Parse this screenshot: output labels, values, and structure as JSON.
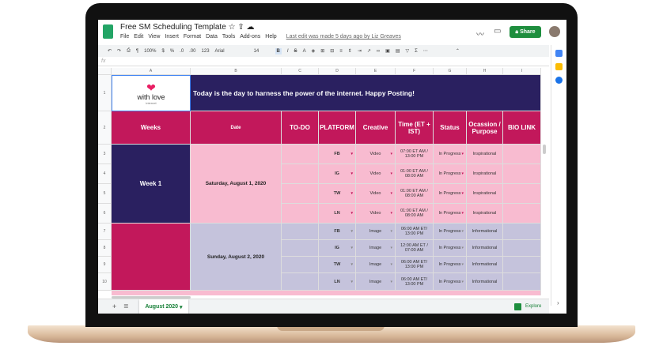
{
  "app": {
    "title": "Free SM Scheduling Template",
    "last_edit": "Last edit was made 5 days ago by Liz Greaves",
    "share": "Share",
    "explore": "Explore"
  },
  "menu": [
    "File",
    "Edit",
    "View",
    "Insert",
    "Format",
    "Data",
    "Tools",
    "Add-ons",
    "Help"
  ],
  "toolbar": {
    "zoom": "100%",
    "currency": "$",
    "percent": "%",
    "dec_less": ".0",
    "dec_more": ".00",
    "format": "123",
    "font": "Arial",
    "size": "14",
    "bold": "B",
    "italic": "I",
    "strike": "S",
    "textcolor": "A"
  },
  "formula": {
    "fx": "fx"
  },
  "columns": [
    "A",
    "B",
    "C",
    "D",
    "E",
    "F",
    "G",
    "H",
    "I"
  ],
  "rows": [
    "1",
    "2",
    "3",
    "4",
    "5",
    "6",
    "7",
    "8",
    "9",
    "10"
  ],
  "banner": {
    "logo_text": "with love",
    "logo_sub": "internet",
    "message": "Today is the day to harness the power of the internet. Happy Posting!"
  },
  "headers": [
    "Weeks",
    "Date",
    "TO-DO",
    "PLATFORM",
    "Creative",
    "Time (ET + IST)",
    "Status",
    "Ocassion / Purpose",
    "BIO LINK"
  ],
  "weeks": [
    {
      "week": "Week 1",
      "date": "Saturday, August 1, 2020",
      "entries": [
        {
          "platform": "FB",
          "creative": "Video",
          "time": "07:00 ET AM / 13:00 PM",
          "status": "In Progress",
          "purpose": "Inspirational"
        },
        {
          "platform": "IG",
          "creative": "Video",
          "time": "01:00 ET AM / 08:00 AM",
          "status": "In Progress",
          "purpose": "Inspirational"
        },
        {
          "platform": "TW",
          "creative": "Video",
          "time": "01:00 ET AM / 08:00 AM",
          "status": "In Progress",
          "purpose": "Inspirational"
        },
        {
          "platform": "LN",
          "creative": "Video",
          "time": "01:00 ET AM / 08:00 AM",
          "status": "In Progress",
          "purpose": "Inspirational"
        }
      ]
    },
    {
      "week": "",
      "date": "Sunday, August 2, 2020",
      "entries": [
        {
          "platform": "FB",
          "creative": "Image",
          "time": "06:00 AM ET/ 13:00 PM",
          "status": "In Progress",
          "purpose": "Informational"
        },
        {
          "platform": "IG",
          "creative": "Image",
          "time": "12:00 AM ET / 07:00 AM",
          "status": "In Progress",
          "purpose": "Informational"
        },
        {
          "platform": "TW",
          "creative": "Image",
          "time": "06:00 AM ET/ 13:00 PM",
          "status": "In Progress",
          "purpose": "Informational"
        },
        {
          "platform": "LN",
          "creative": "Image",
          "time": "06:00 AM ET/ 13:00 PM",
          "status": "In Progress",
          "purpose": "Informational"
        }
      ]
    }
  ],
  "sheet_tab": "August 2020",
  "colors": {
    "navy": "#2a2060",
    "magenta": "#c2185b",
    "pink": "#f8bbd0",
    "lavender": "#c5c3dc",
    "green": "#1e8e3e"
  }
}
